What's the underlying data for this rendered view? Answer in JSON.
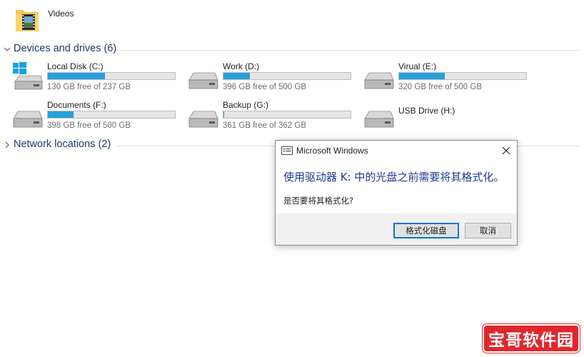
{
  "folders": [
    {
      "label": "Videos",
      "icon": "video-folder-icon"
    }
  ],
  "groups": {
    "devices": {
      "title": "Devices and drives (6)",
      "expanded": true
    },
    "network": {
      "title": "Network locations (2)",
      "expanded": false
    }
  },
  "drives": [
    {
      "name": "Local Disk (C:)",
      "free_text": "130 GB free of 237 GB",
      "used_fraction": 0.45,
      "icon": "windows-drive-icon"
    },
    {
      "name": "Work (D:)",
      "free_text": "396 GB free of 500 GB",
      "used_fraction": 0.21,
      "icon": "hard-drive-icon"
    },
    {
      "name": "Virual (E:)",
      "free_text": "320 GB free of 500 GB",
      "used_fraction": 0.36,
      "icon": "hard-drive-icon"
    },
    {
      "name": "Documents (F:)",
      "free_text": "398 GB free of 500 GB",
      "used_fraction": 0.2,
      "icon": "hard-drive-icon"
    },
    {
      "name": "Backup (G:)",
      "free_text": "361 GB free of 362 GB",
      "used_fraction": 0.003,
      "icon": "hard-drive-icon"
    },
    {
      "name": "USB Drive (H:)",
      "free_text": "",
      "used_fraction": null,
      "icon": "usb-drive-icon"
    }
  ],
  "dialog": {
    "title": "Microsoft Windows",
    "message": "使用驱动器 K: 中的光盘之前需要将其格式化。",
    "question": "是否要将其格式化?",
    "format_button": "格式化磁盘",
    "cancel_button": "取消"
  },
  "watermark": "宝哥软件园",
  "colors": {
    "bar_fill": "#26a0da",
    "bar_track": "#e6e6e6",
    "group_title": "#1e3a6e",
    "dialog_message": "#1f3a93",
    "watermark_bg": "#e0272b"
  }
}
